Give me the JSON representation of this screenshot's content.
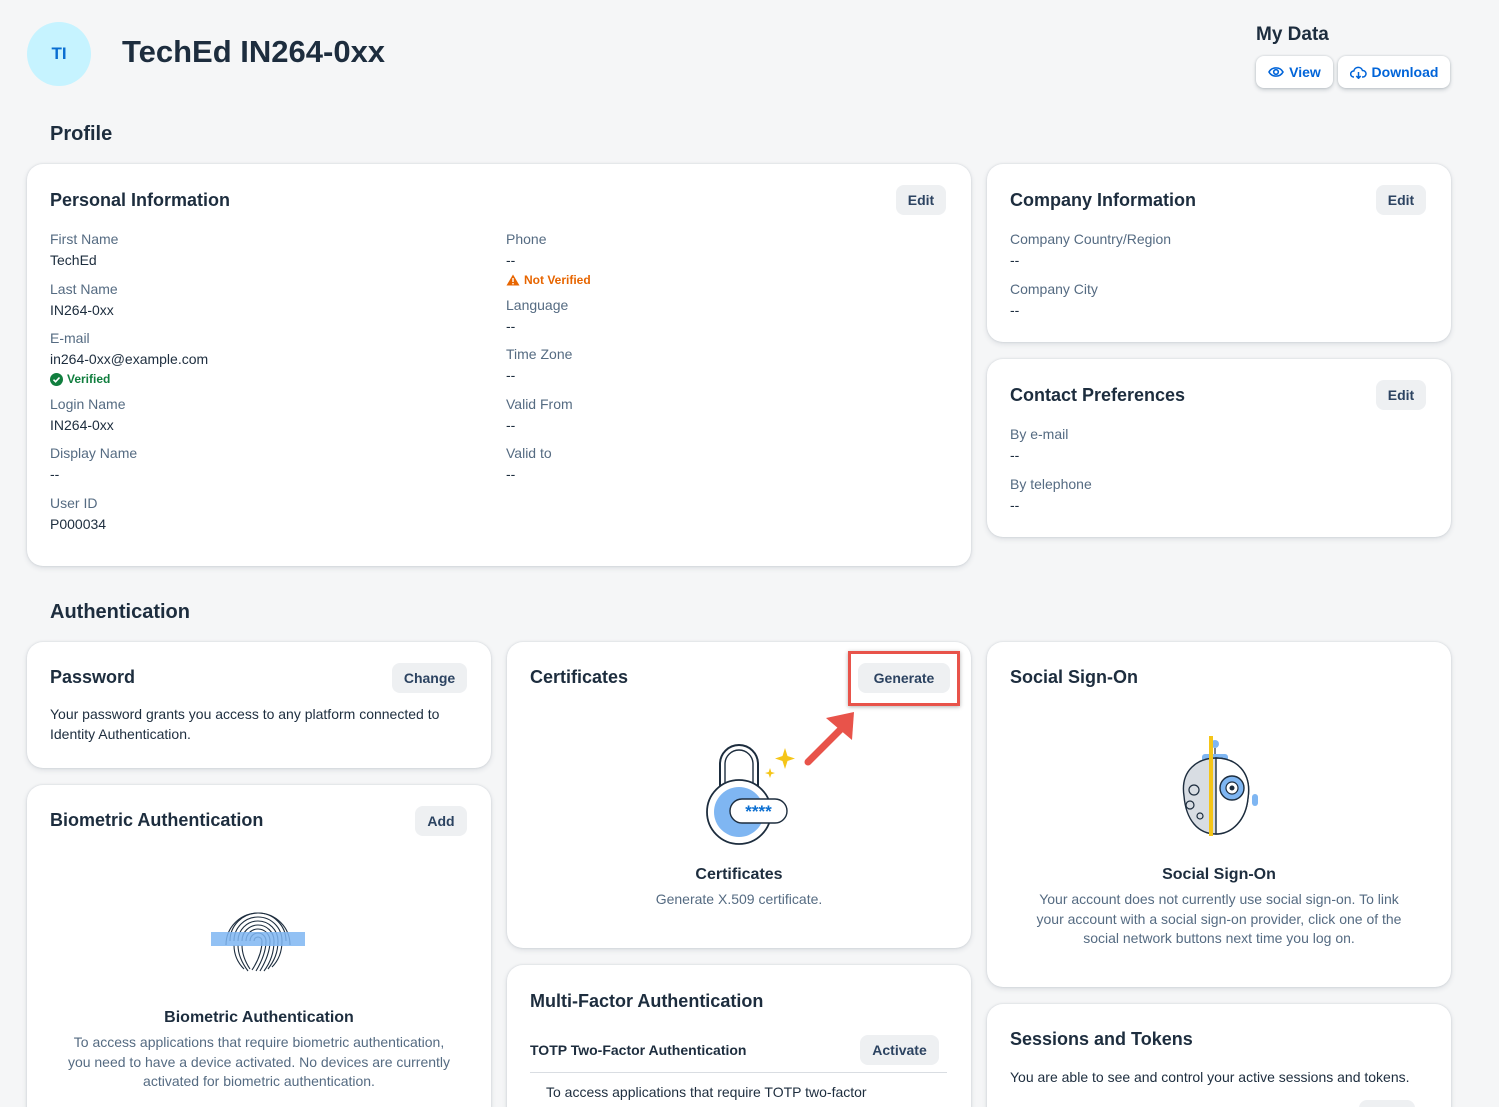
{
  "header": {
    "avatar_initials": "TI",
    "user_title": "TechEd IN264-0xx",
    "my_data": {
      "title": "My Data",
      "view_label": "View",
      "download_label": "Download"
    }
  },
  "profile": {
    "section_title": "Profile",
    "personal": {
      "title": "Personal Information",
      "edit_label": "Edit",
      "left_fields": [
        {
          "label": "First Name",
          "value": "TechEd"
        },
        {
          "label": "Last Name",
          "value": "IN264-0xx"
        },
        {
          "label": "E-mail",
          "value": "in264-0xx@example.com",
          "status": "Verified"
        },
        {
          "label": "Login Name",
          "value": "IN264-0xx"
        },
        {
          "label": "Display Name",
          "value": "--"
        },
        {
          "label": "User ID",
          "value": "P000034"
        }
      ],
      "right_fields": [
        {
          "label": "Phone",
          "value": "--",
          "status": "Not Verified"
        },
        {
          "label": "Language",
          "value": "--"
        },
        {
          "label": "Time Zone",
          "value": "--"
        },
        {
          "label": "Valid From",
          "value": "--"
        },
        {
          "label": "Valid to",
          "value": "--"
        }
      ]
    },
    "company": {
      "title": "Company Information",
      "edit_label": "Edit",
      "fields": [
        {
          "label": "Company Country/Region",
          "value": "--"
        },
        {
          "label": "Company City",
          "value": "--"
        }
      ]
    },
    "contact": {
      "title": "Contact Preferences",
      "edit_label": "Edit",
      "fields": [
        {
          "label": "By e-mail",
          "value": "--"
        },
        {
          "label": "By telephone",
          "value": "--"
        }
      ]
    }
  },
  "authentication": {
    "section_title": "Authentication",
    "password": {
      "title": "Password",
      "button_label": "Change",
      "description": "Your password grants you access to any platform connected to Identity Authentication."
    },
    "biometric": {
      "title": "Biometric Authentication",
      "button_label": "Add",
      "illustration_title": "Biometric Authentication",
      "description": "To access applications that require biometric authentication, you need to have a device activated. No devices are currently activated for biometric authentication."
    },
    "certificates": {
      "title": "Certificates",
      "button_label": "Generate",
      "illustration_title": "Certificates",
      "description": "Generate X.509 certificate.",
      "lock_text": "****"
    },
    "mfa": {
      "title": "Multi-Factor Authentication",
      "totp_label": "TOTP Two-Factor Authentication",
      "activate_label": "Activate",
      "description": "To access applications that require TOTP two-factor"
    },
    "social": {
      "title": "Social Sign-On",
      "illustration_title": "Social Sign-On",
      "description": "Your account does not currently use social sign-on. To link your account with a social sign-on provider, click one of the social network buttons next time you log on."
    },
    "sessions": {
      "title": "Sessions and Tokens",
      "description": "You are able to see and control your active sessions and tokens."
    }
  },
  "colors": {
    "accent": "#0064d9",
    "warning": "#e76500",
    "success": "#107e3e",
    "highlight": "#e8534a"
  }
}
